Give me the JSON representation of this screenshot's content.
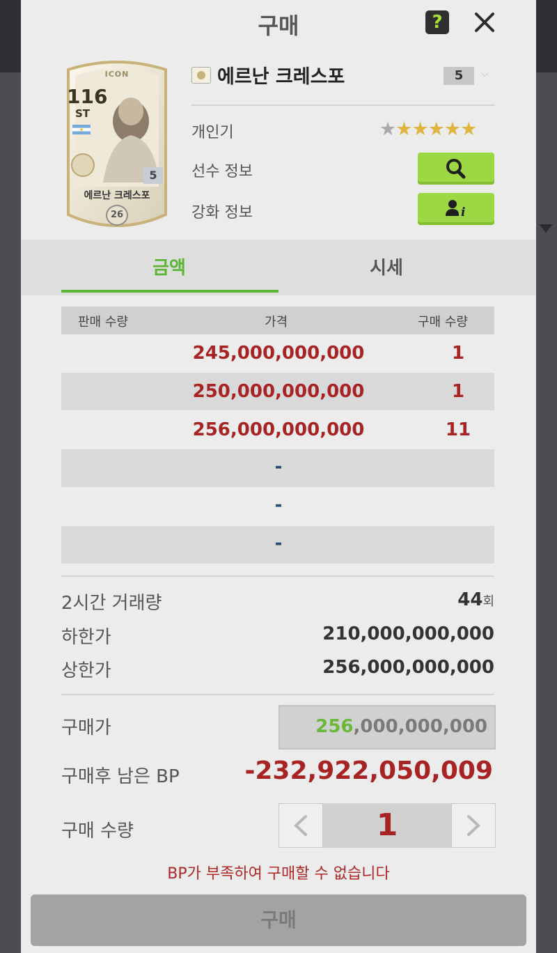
{
  "dialog": {
    "title": "구매",
    "help_label": "?"
  },
  "player": {
    "card": {
      "label": "ICON",
      "overall": "116",
      "position": "ST",
      "enhance": "5",
      "name": "에르난 크레스포",
      "season_mark": "26"
    },
    "name": "에르난 크레스포",
    "enhance_level": "5",
    "popularity_label": "개인기",
    "popularity": {
      "filled": 5,
      "total": 6
    },
    "info_label": "선수 정보",
    "enhance_info_label": "강화 정보"
  },
  "tabs": [
    {
      "label": "금액",
      "active": true
    },
    {
      "label": "시세",
      "active": false
    }
  ],
  "listing": {
    "headers": {
      "sell_qty": "판매 수량",
      "price": "가격",
      "buy_qty": "구매 수량"
    },
    "rows": [
      {
        "price": "245,000,000,000",
        "qty": "1"
      },
      {
        "price": "250,000,000,000",
        "qty": "1"
      },
      {
        "price": "256,000,000,000",
        "qty": "11"
      },
      {
        "dash": "-"
      },
      {
        "dash": "-"
      },
      {
        "dash": "-"
      }
    ]
  },
  "stats": {
    "volume_label": "2시간 거래량",
    "volume_value": "44",
    "volume_unit": "회",
    "min_label": "하한가",
    "min_value": "210,000,000,000",
    "max_label": "상한가",
    "max_value": "256,000,000,000"
  },
  "purchase": {
    "price_label": "구매가",
    "price_highlight": "256",
    "price_rest": ",000,000,000",
    "remaining_label": "구매후 남은 BP",
    "remaining_value": "-232,922,050,009",
    "qty_label": "구매 수량",
    "qty_value": "1",
    "warning": "BP가 부족하여 구매할 수 없습니다",
    "buy_label": "구매"
  },
  "colors": {
    "accent_green": "#9bd844",
    "tab_green": "#5bb536",
    "price_red": "#a82424",
    "star_gold": "#e0b53e"
  }
}
